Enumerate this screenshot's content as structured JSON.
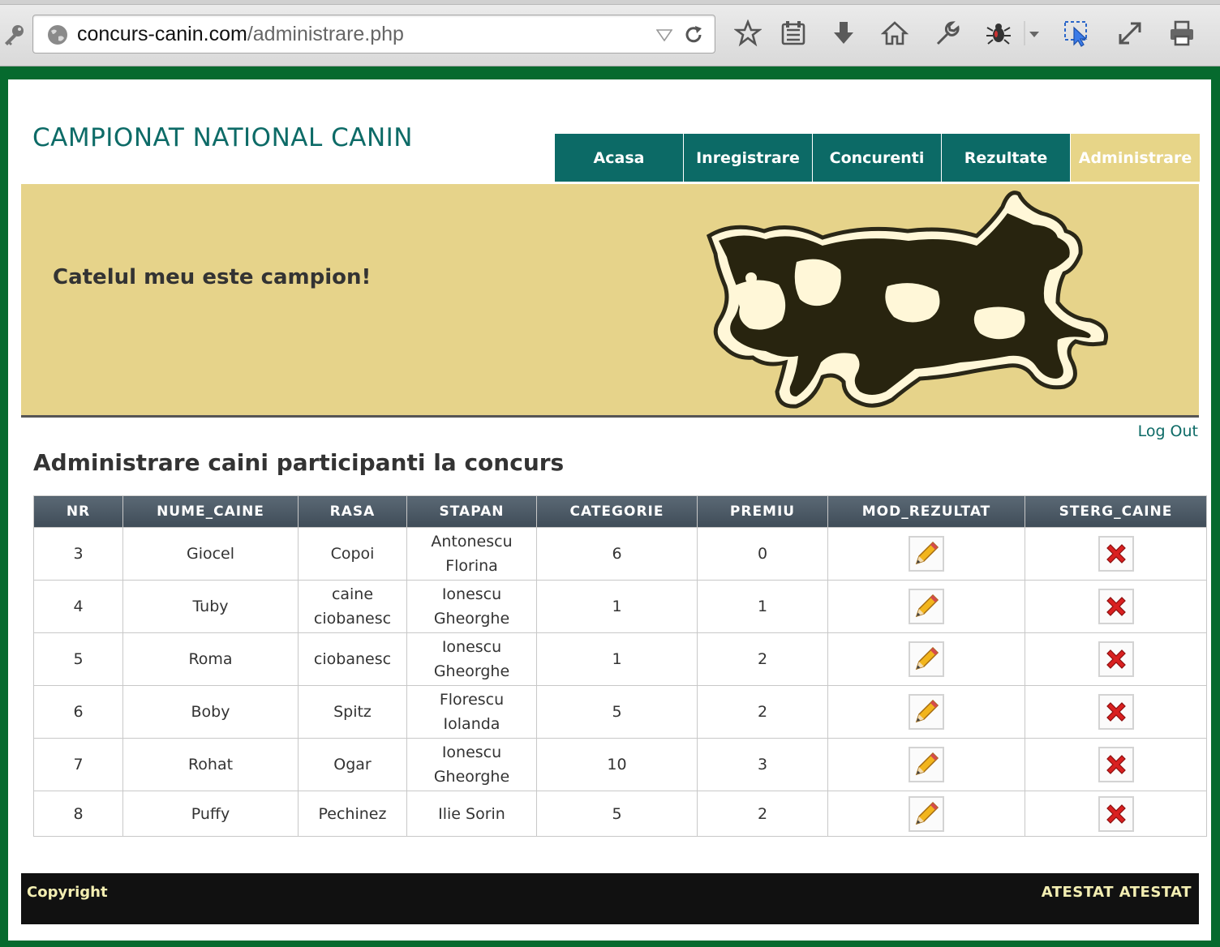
{
  "browser": {
    "url_domain": "concurs-canin.com",
    "url_path": "/administrare.php"
  },
  "site": {
    "title": "CAMPIONAT NATIONAL CANIN",
    "nav": [
      {
        "label": "Acasa"
      },
      {
        "label": "Inregistrare"
      },
      {
        "label": "Concurenti"
      },
      {
        "label": "Rezultate"
      },
      {
        "label": "Administrare",
        "active": true
      }
    ],
    "tagline": "Catelul meu este campion!",
    "logout": "Log Out",
    "section_title": "Administrare caini participanti la concurs"
  },
  "table": {
    "headers": [
      "NR",
      "NUME_CAINE",
      "RASA",
      "STAPAN",
      "CATEGORIE",
      "PREMIU",
      "MOD_REZULTAT",
      "STERG_CAINE"
    ],
    "rows": [
      {
        "nr": "3",
        "nume": "Giocel",
        "rasa": "Copoi",
        "stapan_l1": "Antonescu",
        "stapan_l2": "Florina",
        "categorie": "6",
        "premiu": "0"
      },
      {
        "nr": "4",
        "nume": "Tuby",
        "rasa_l1": "caine",
        "rasa_l2": "ciobanesc",
        "stapan_l1": "Ionescu",
        "stapan_l2": "Gheorghe",
        "categorie": "1",
        "premiu": "1"
      },
      {
        "nr": "5",
        "nume": "Roma",
        "rasa": "ciobanesc",
        "stapan_l1": "Ionescu",
        "stapan_l2": "Gheorghe",
        "categorie": "1",
        "premiu": "2"
      },
      {
        "nr": "6",
        "nume": "Boby",
        "rasa": "Spitz",
        "stapan_l1": "Florescu",
        "stapan_l2": "Iolanda",
        "categorie": "5",
        "premiu": "2"
      },
      {
        "nr": "7",
        "nume": "Rohat",
        "rasa": "Ogar",
        "stapan_l1": "Ionescu",
        "stapan_l2": "Gheorghe",
        "categorie": "10",
        "premiu": "3"
      },
      {
        "nr": "8",
        "nume": "Puffy",
        "rasa": "Pechinez",
        "stapan": "Ilie Sorin",
        "categorie": "5",
        "premiu": "2"
      }
    ]
  },
  "footer": {
    "copyright": "Copyright",
    "right": "ATESTAT ATESTAT"
  },
  "colors": {
    "frame_green": "#066a2e",
    "nav_teal": "#0c6a66",
    "banner_tan": "#e6d38a",
    "footer_black": "#111111",
    "footer_text": "#f3eeb2"
  },
  "icons": {
    "edit": "pencil-icon",
    "delete": "red-x-icon",
    "banner": "dog-logo"
  }
}
